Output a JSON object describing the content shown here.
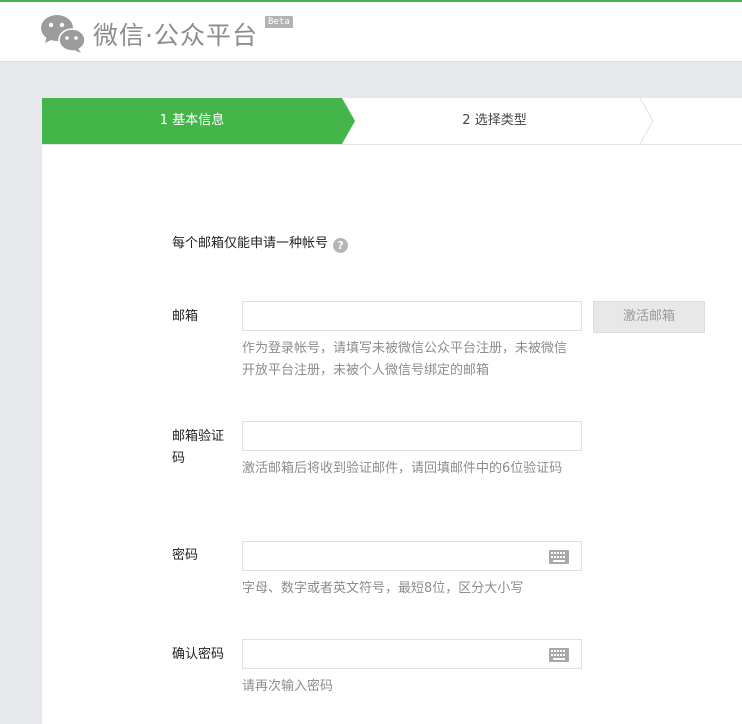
{
  "header": {
    "logo_text": "微信·公众平台",
    "beta": "Beta"
  },
  "steps": [
    {
      "label": "1 基本信息",
      "active": true
    },
    {
      "label": "2 选择类型",
      "active": false
    }
  ],
  "form": {
    "notice": "每个邮箱仅能申请一种帐号",
    "email": {
      "label": "邮箱",
      "value": "",
      "activate_button": "激活邮箱",
      "tip": "作为登录帐号，请填写未被微信公众平台注册，未被微信开放平台注册，未被个人微信号绑定的邮箱"
    },
    "code": {
      "label": "邮箱验证码",
      "value": "",
      "tip": "激活邮箱后将收到验证邮件，请回填邮件中的6位验证码"
    },
    "password": {
      "label": "密码",
      "value": "",
      "tip": "字母、数字或者英文符号，最短8位，区分大小写"
    },
    "confirm": {
      "label": "确认密码",
      "value": "",
      "tip": "请再次输入密码"
    }
  },
  "colors": {
    "brand_green": "#44b549",
    "muted_text": "#8d8d8d"
  }
}
